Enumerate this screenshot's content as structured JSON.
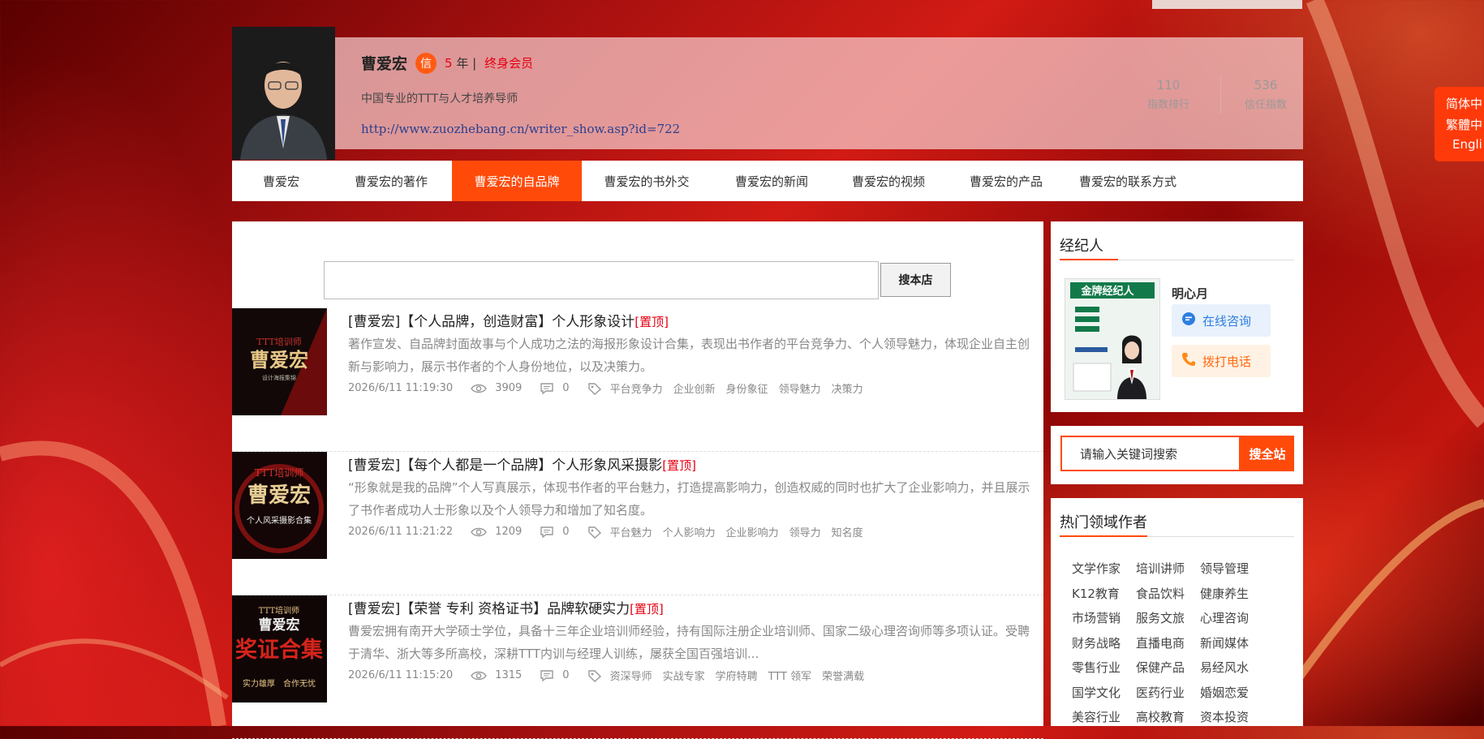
{
  "profile": {
    "name": "曹爱宏",
    "badge": "信",
    "years_num": "5",
    "years_unit": "年 |",
    "member": "终身会员",
    "slogan": "中国专业的TTT与人才培养导师",
    "url": "http://www.zuozhebang.cn/writer_show.asp?id=722",
    "stats": [
      {
        "value": "110",
        "label": "指数排行"
      },
      {
        "value": "536",
        "label": "信任指数"
      }
    ]
  },
  "nav": {
    "items": [
      {
        "label": "曹爱宏"
      },
      {
        "label": "曹爱宏的著作"
      },
      {
        "label": "曹爱宏的自品牌"
      },
      {
        "label": "曹爱宏的书外交"
      },
      {
        "label": "曹爱宏的新闻"
      },
      {
        "label": "曹爱宏的视频"
      },
      {
        "label": "曹爱宏的产品"
      },
      {
        "label": "曹爱宏的联系方式"
      }
    ],
    "active_index": 2
  },
  "lang": [
    "简体中",
    "繁體中",
    "Engli"
  ],
  "store_search": {
    "placeholder": "",
    "button": "搜本店"
  },
  "articles": [
    {
      "title": "[曹爱宏]【个人品牌，创造财富】个人形象设计",
      "pin": "[置顶]",
      "desc": "著作宣发、自品牌封面故事与个人成功之法的海报形象设计合集，表现出书作者的平台竞争力、个人领导魅力，体现企业自主创新与影响力，展示书作者的个人身份地位，以及决策力。",
      "date": "2026/6/11 11:19:30",
      "views": "3909",
      "comments": "0",
      "tags": [
        "平台竞争力",
        "企业创新",
        "身份象征",
        "领导魅力",
        "决策力"
      ],
      "thumb": {
        "l1": "TTT培训师",
        "l2": "曹爱宏",
        "l3": "设计海报集锦"
      }
    },
    {
      "title": "[曹爱宏]【每个人都是一个品牌】个人形象风采摄影",
      "pin": "[置顶]",
      "desc": "“形象就是我的品牌”个人写真展示，体现书作者的平台魅力，打造提高影响力，创造权威的同时也扩大了企业影响力，并且展示了书作者成功人士形象以及个人领导力和增加了知名度。",
      "date": "2026/6/11 11:21:22",
      "views": "1209",
      "comments": "0",
      "tags": [
        "平台魅力",
        "个人影响力",
        "企业影响力",
        "领导力",
        "知名度"
      ],
      "thumb": {
        "l1": "TTT培训师",
        "l2": "曹爱宏",
        "l3": "个人风采摄影合集"
      }
    },
    {
      "title": "[曹爱宏]【荣誉 专利 资格证书】品牌软硬实力",
      "pin": "[置顶]",
      "desc": "曹爱宏拥有南开大学硕士学位，具备十三年企业培训师经验，持有国际注册企业培训师、国家二级心理咨询师等多项认证。受聘于清华、浙大等多所高校，深耕TTT内训与经理人训练，屡获全国百强培训...",
      "date": "2026/6/11 11:15:20",
      "views": "1315",
      "comments": "0",
      "tags": [
        "资深导师",
        "实战专家",
        "学府特聘",
        "TTT 领军",
        "荣誉满载"
      ],
      "thumb": {
        "l1": "TTT培训师",
        "l2": "曹爱宏",
        "l3": "奖证合集",
        "l4": "实力雄厚　合作无忧"
      }
    }
  ],
  "agent": {
    "title": "经纪人",
    "name": "明心月",
    "consult": "在线咨询",
    "call": "拨打电话",
    "card_title": "金牌经纪人"
  },
  "global_search": {
    "placeholder": "请输入关键词搜索",
    "button": "搜全站"
  },
  "hot": {
    "title": "热门领域作者",
    "items": [
      "文学作家",
      "培训讲师",
      "领导管理",
      "K12教育",
      "食品饮料",
      "健康养生",
      "市场营销",
      "服务文旅",
      "心理咨询",
      "财务战略",
      "直播电商",
      "新闻媒体",
      "零售行业",
      "保健产品",
      "易经风水",
      "国学文化",
      "医药行业",
      "婚姻恋爱",
      "美容行业",
      "高校教育",
      "资本投资"
    ]
  },
  "colors": {
    "accent": "#ff4a0a",
    "pin": "#e60012",
    "link": "#2a3f8f"
  }
}
